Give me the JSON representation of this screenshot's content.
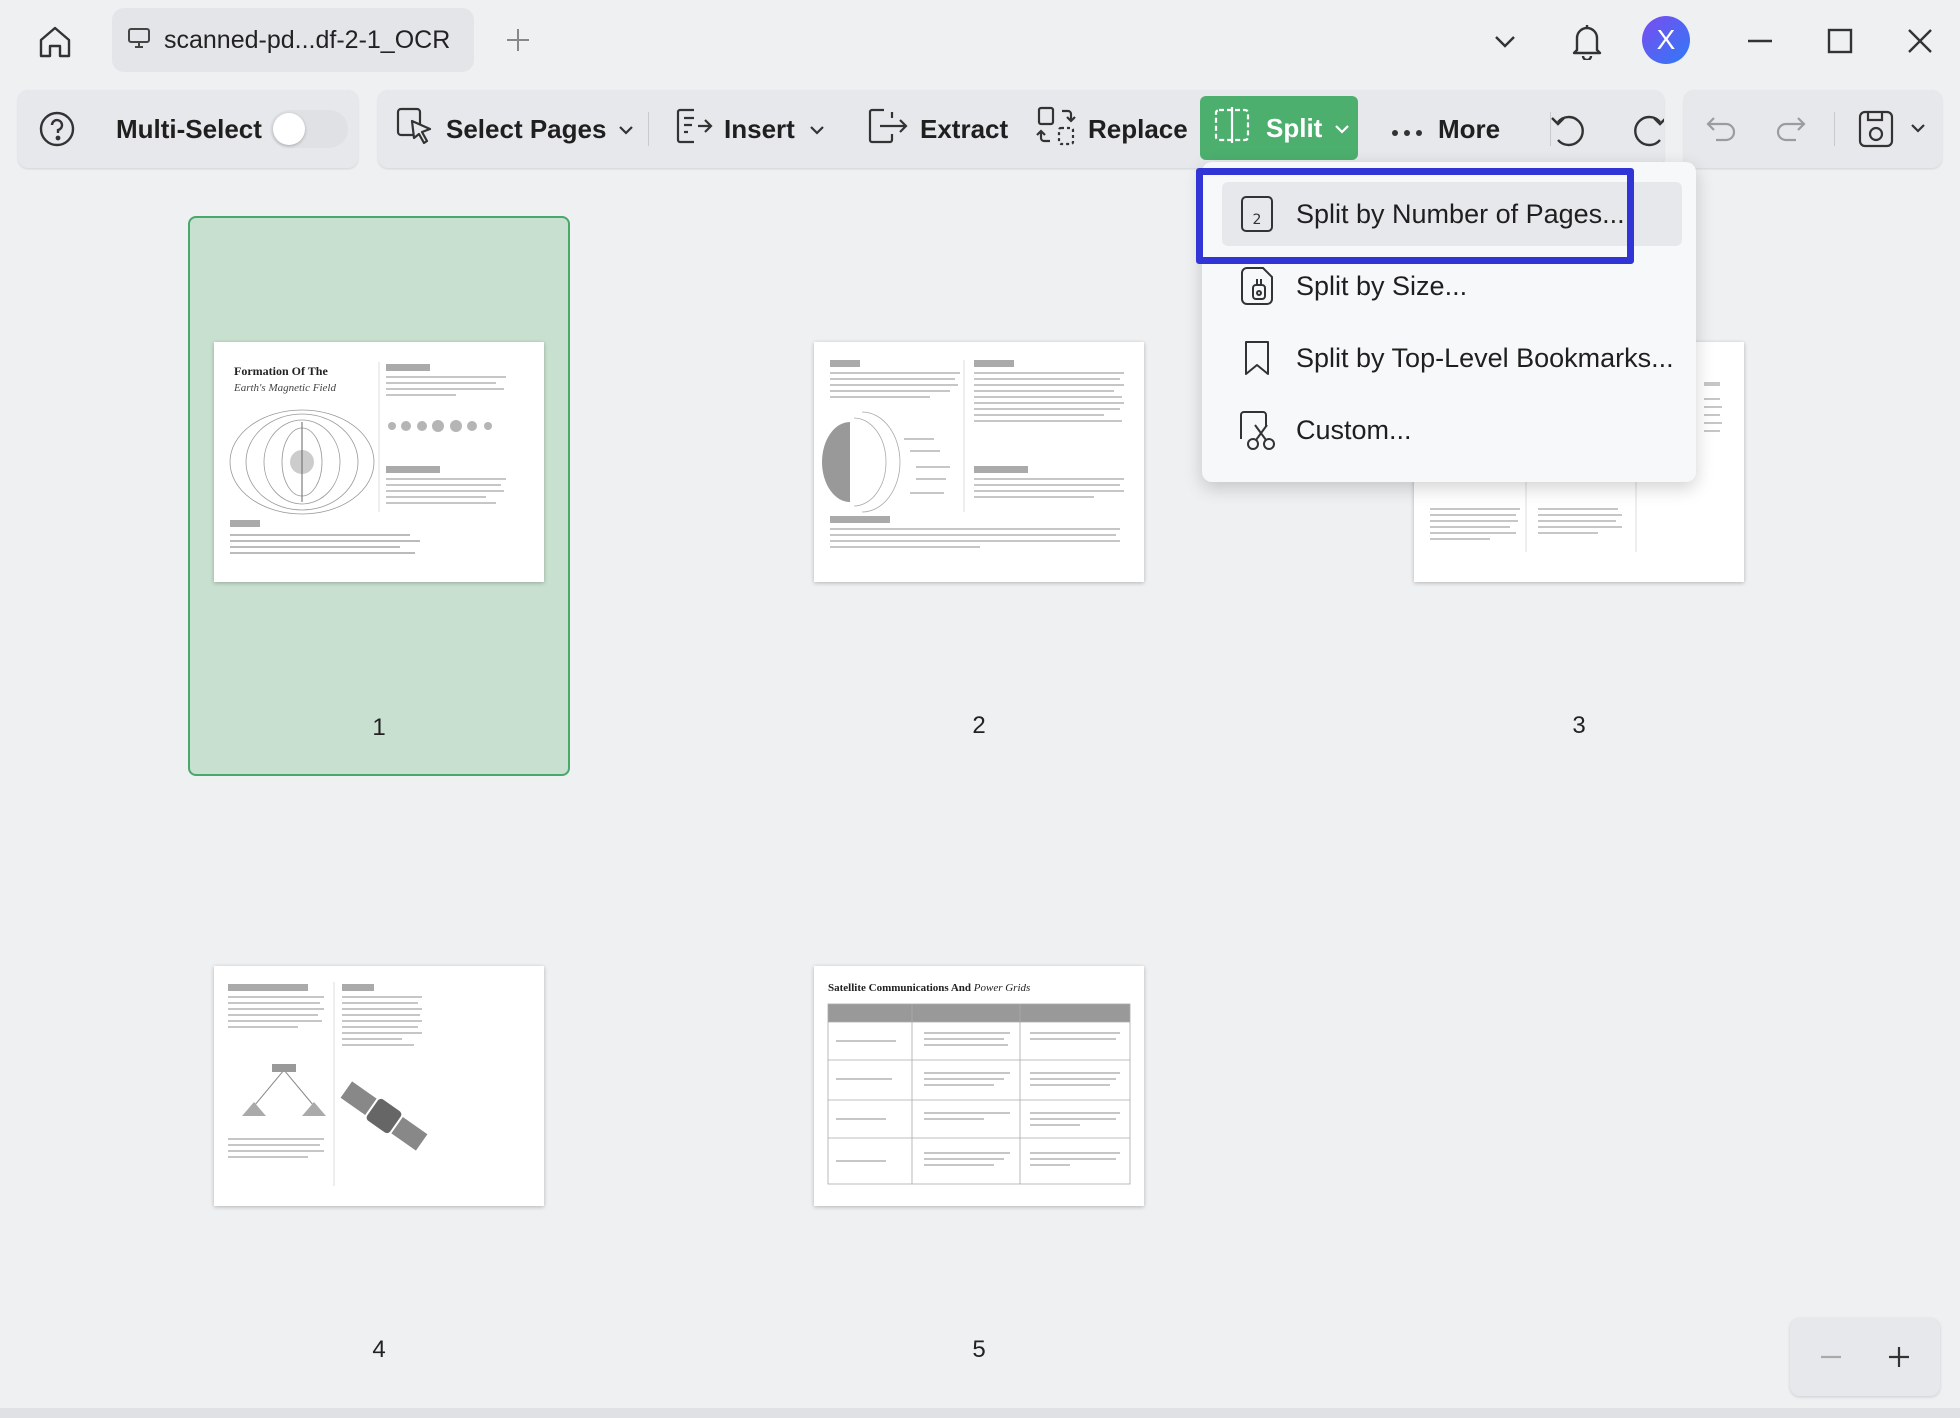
{
  "window": {
    "tab_title": "scanned-pd...df-2-1_OCR",
    "avatar_letter": "X"
  },
  "toolbar": {
    "multi_select_label": "Multi-Select",
    "multi_select_on": false,
    "select_pages_label": "Select Pages",
    "insert_label": "Insert",
    "extract_label": "Extract",
    "replace_label": "Replace",
    "split_label": "Split",
    "more_label": "More"
  },
  "split_menu": {
    "items": [
      {
        "label": "Split by Number of Pages...",
        "icon": "number-pages-icon",
        "highlighted": true
      },
      {
        "label": "Split by Size...",
        "icon": "file-size-icon"
      },
      {
        "label": "Split by Top-Level Bookmarks...",
        "icon": "bookmark-icon"
      },
      {
        "label": "Custom...",
        "icon": "scissors-icon"
      }
    ]
  },
  "pages": [
    {
      "number": "1",
      "selected": true,
      "thumb_title": "Formation Of The",
      "thumb_subtitle": "Earth's Magnetic Field"
    },
    {
      "number": "2",
      "selected": false
    },
    {
      "number": "3",
      "selected": false
    },
    {
      "number": "4",
      "selected": false
    },
    {
      "number": "5",
      "selected": false,
      "thumb_title": "Satellite Communications And",
      "thumb_subtitle": "Power Grids"
    }
  ],
  "colors": {
    "accent_green": "#4caf6e",
    "selection_fill": "#c8e0cf",
    "highlight_blue": "#3235d6"
  }
}
